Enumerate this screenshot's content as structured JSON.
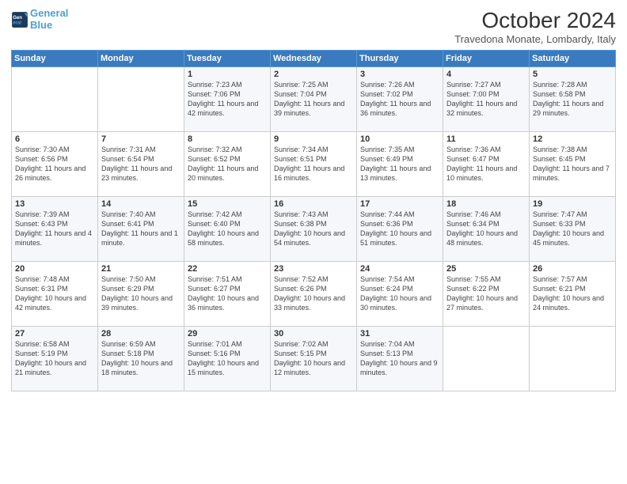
{
  "header": {
    "logo_line1": "General",
    "logo_line2": "Blue",
    "month_title": "October 2024",
    "subtitle": "Travedona Monate, Lombardy, Italy"
  },
  "days_of_week": [
    "Sunday",
    "Monday",
    "Tuesday",
    "Wednesday",
    "Thursday",
    "Friday",
    "Saturday"
  ],
  "weeks": [
    [
      {
        "day": "",
        "info": ""
      },
      {
        "day": "",
        "info": ""
      },
      {
        "day": "1",
        "info": "Sunrise: 7:23 AM\nSunset: 7:06 PM\nDaylight: 11 hours and 42 minutes."
      },
      {
        "day": "2",
        "info": "Sunrise: 7:25 AM\nSunset: 7:04 PM\nDaylight: 11 hours and 39 minutes."
      },
      {
        "day": "3",
        "info": "Sunrise: 7:26 AM\nSunset: 7:02 PM\nDaylight: 11 hours and 36 minutes."
      },
      {
        "day": "4",
        "info": "Sunrise: 7:27 AM\nSunset: 7:00 PM\nDaylight: 11 hours and 32 minutes."
      },
      {
        "day": "5",
        "info": "Sunrise: 7:28 AM\nSunset: 6:58 PM\nDaylight: 11 hours and 29 minutes."
      }
    ],
    [
      {
        "day": "6",
        "info": "Sunrise: 7:30 AM\nSunset: 6:56 PM\nDaylight: 11 hours and 26 minutes."
      },
      {
        "day": "7",
        "info": "Sunrise: 7:31 AM\nSunset: 6:54 PM\nDaylight: 11 hours and 23 minutes."
      },
      {
        "day": "8",
        "info": "Sunrise: 7:32 AM\nSunset: 6:52 PM\nDaylight: 11 hours and 20 minutes."
      },
      {
        "day": "9",
        "info": "Sunrise: 7:34 AM\nSunset: 6:51 PM\nDaylight: 11 hours and 16 minutes."
      },
      {
        "day": "10",
        "info": "Sunrise: 7:35 AM\nSunset: 6:49 PM\nDaylight: 11 hours and 13 minutes."
      },
      {
        "day": "11",
        "info": "Sunrise: 7:36 AM\nSunset: 6:47 PM\nDaylight: 11 hours and 10 minutes."
      },
      {
        "day": "12",
        "info": "Sunrise: 7:38 AM\nSunset: 6:45 PM\nDaylight: 11 hours and 7 minutes."
      }
    ],
    [
      {
        "day": "13",
        "info": "Sunrise: 7:39 AM\nSunset: 6:43 PM\nDaylight: 11 hours and 4 minutes."
      },
      {
        "day": "14",
        "info": "Sunrise: 7:40 AM\nSunset: 6:41 PM\nDaylight: 11 hours and 1 minute."
      },
      {
        "day": "15",
        "info": "Sunrise: 7:42 AM\nSunset: 6:40 PM\nDaylight: 10 hours and 58 minutes."
      },
      {
        "day": "16",
        "info": "Sunrise: 7:43 AM\nSunset: 6:38 PM\nDaylight: 10 hours and 54 minutes."
      },
      {
        "day": "17",
        "info": "Sunrise: 7:44 AM\nSunset: 6:36 PM\nDaylight: 10 hours and 51 minutes."
      },
      {
        "day": "18",
        "info": "Sunrise: 7:46 AM\nSunset: 6:34 PM\nDaylight: 10 hours and 48 minutes."
      },
      {
        "day": "19",
        "info": "Sunrise: 7:47 AM\nSunset: 6:33 PM\nDaylight: 10 hours and 45 minutes."
      }
    ],
    [
      {
        "day": "20",
        "info": "Sunrise: 7:48 AM\nSunset: 6:31 PM\nDaylight: 10 hours and 42 minutes."
      },
      {
        "day": "21",
        "info": "Sunrise: 7:50 AM\nSunset: 6:29 PM\nDaylight: 10 hours and 39 minutes."
      },
      {
        "day": "22",
        "info": "Sunrise: 7:51 AM\nSunset: 6:27 PM\nDaylight: 10 hours and 36 minutes."
      },
      {
        "day": "23",
        "info": "Sunrise: 7:52 AM\nSunset: 6:26 PM\nDaylight: 10 hours and 33 minutes."
      },
      {
        "day": "24",
        "info": "Sunrise: 7:54 AM\nSunset: 6:24 PM\nDaylight: 10 hours and 30 minutes."
      },
      {
        "day": "25",
        "info": "Sunrise: 7:55 AM\nSunset: 6:22 PM\nDaylight: 10 hours and 27 minutes."
      },
      {
        "day": "26",
        "info": "Sunrise: 7:57 AM\nSunset: 6:21 PM\nDaylight: 10 hours and 24 minutes."
      }
    ],
    [
      {
        "day": "27",
        "info": "Sunrise: 6:58 AM\nSunset: 5:19 PM\nDaylight: 10 hours and 21 minutes."
      },
      {
        "day": "28",
        "info": "Sunrise: 6:59 AM\nSunset: 5:18 PM\nDaylight: 10 hours and 18 minutes."
      },
      {
        "day": "29",
        "info": "Sunrise: 7:01 AM\nSunset: 5:16 PM\nDaylight: 10 hours and 15 minutes."
      },
      {
        "day": "30",
        "info": "Sunrise: 7:02 AM\nSunset: 5:15 PM\nDaylight: 10 hours and 12 minutes."
      },
      {
        "day": "31",
        "info": "Sunrise: 7:04 AM\nSunset: 5:13 PM\nDaylight: 10 hours and 9 minutes."
      },
      {
        "day": "",
        "info": ""
      },
      {
        "day": "",
        "info": ""
      }
    ]
  ]
}
